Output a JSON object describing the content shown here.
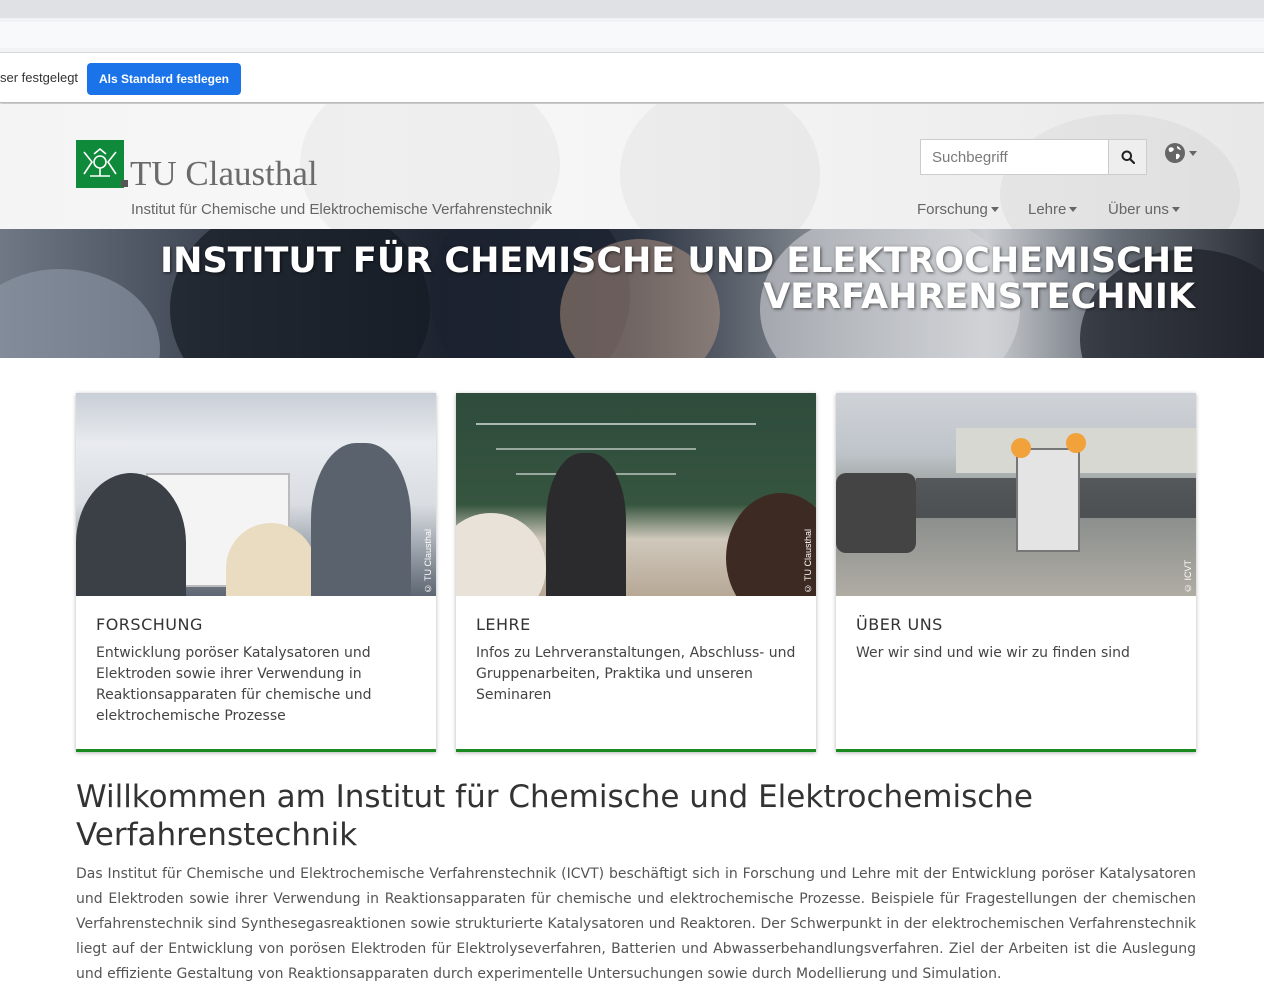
{
  "browser": {
    "infobar_message": "ser festgelegt",
    "infobar_button": "Als Standard festlegen"
  },
  "header": {
    "logo_text": "TU Clausthal",
    "institute_subtitle": "Institut für Chemische und Elektrochemische Verfahrenstechnik",
    "search_placeholder": "Suchbegriff",
    "nav": [
      {
        "label": "Forschung"
      },
      {
        "label": "Lehre"
      },
      {
        "label": "Über uns"
      }
    ]
  },
  "banner": {
    "title_line1": "INSTITUT FÜR CHEMISCHE UND ELEKTROCHEMISCHE",
    "title_line2": "VERFAHRENSTECHNIK"
  },
  "cards": [
    {
      "title": "FORSCHUNG",
      "text": "Entwicklung poröser Katalysatoren und Elektroden sowie ihrer Verwendung in Reaktionsapparaten für chemische und elektrochemische Prozesse",
      "credit": "© TU Clausthal"
    },
    {
      "title": "LEHRE",
      "text": "Infos zu Lehrveranstaltungen, Abschluss- und Gruppenarbeiten, Praktika und unseren Seminaren",
      "credit": "© TU Clausthal"
    },
    {
      "title": "ÜBER UNS",
      "text": "Wer wir sind und wie wir zu finden sind",
      "credit": "© ICVT"
    }
  ],
  "welcome": {
    "title": "Willkommen am Institut für Chemische und Elektrochemische Verfahrenstechnik",
    "text": "Das Institut für Chemische und Elektrochemische Verfahrenstechnik (ICVT) beschäftigt sich in Forschung und Lehre mit der Entwicklung poröser Katalysatoren und Elektroden sowie ihrer Verwendung in Reaktionsapparaten für chemische und elektrochemische Prozesse. Beispiele für Fragestellungen der chemischen Verfahrenstechnik sind Synthesegasreaktionen sowie strukturierte Katalysatoren und Reaktoren. Der Schwerpunkt in der elektrochemischen Verfahrenstechnik liegt auf der Entwicklung von porösen Elektroden für Elektrolyseverfahren, Batterien und Abwasserbehandlungsverfahren. Ziel der Arbeiten ist die Auslegung und effiziente Gestaltung von Reaktionsapparaten durch experimentelle Untersuchungen sowie durch Modellierung und Simulation."
  },
  "colors": {
    "accent_green": "#198a1f",
    "logo_green": "#0f8a3a",
    "chrome_button": "#1a73e8"
  },
  "icons": [
    "logo-icon",
    "search-icon",
    "globe-icon",
    "caret-icon"
  ]
}
